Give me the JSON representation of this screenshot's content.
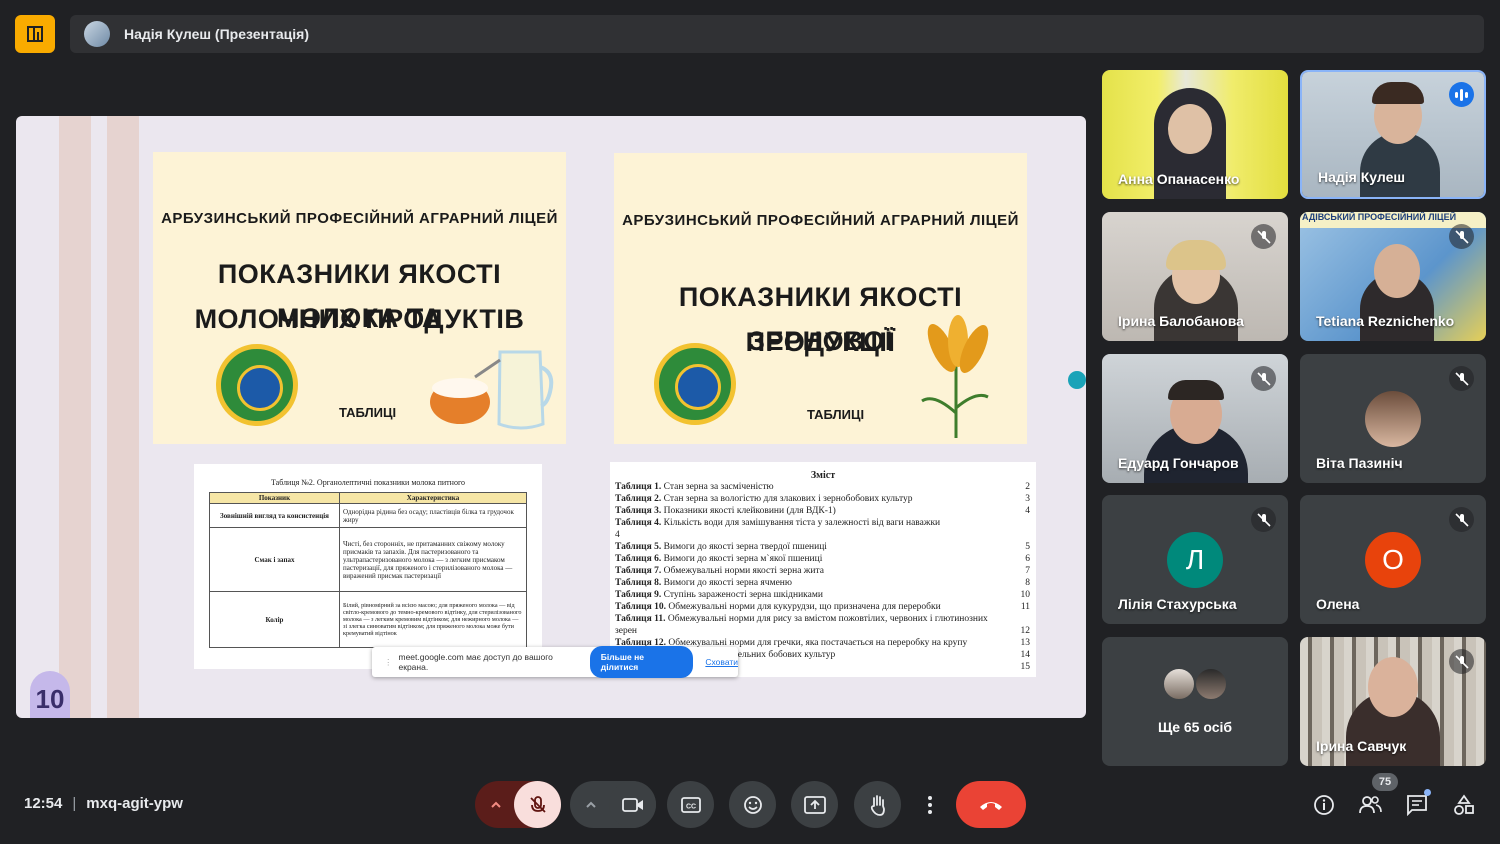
{
  "app": {
    "presenter_label": "Надія Кулеш (Презентація)"
  },
  "slide": {
    "page_number": "10",
    "card_left": {
      "school": "АРБУЗИНСЬКИЙ ПРОФЕСІЙНИЙ АГРАРНИЙ ЛІЦЕЙ",
      "title_line1": "ПОКАЗНИКИ ЯКОСТІ МОЛОКА ТА",
      "title_line2": "МОЛОЧНИХ ПРОДУКТІВ",
      "tables": "ТАБЛИЦІ"
    },
    "card_right": {
      "school": "АРБУЗИНСЬКИЙ ПРОФЕСІЙНИЙ АГРАРНИЙ ЛІЦЕЙ",
      "title_line1": "ПОКАЗНИКИ ЯКОСТІ ЗЕРНОВОЇ",
      "title_line2": "ПРОДУКЦІЇ",
      "tables": "ТАБЛИЦІ"
    },
    "doc_left": {
      "caption": "Таблиця №2. Органолептичні показники молока питного",
      "headers": [
        "Показник",
        "Характеристика"
      ],
      "rows": [
        {
          "label": "Зовнішній вигляд та консистенція",
          "text": "Однорідна рідина без осаду; пластівців білка та грудочок жиру"
        },
        {
          "label": "Смак і запах",
          "text": "Чисті, без сторонніх, не притаманних свіжому молоку присмаків та запахів. Для пастеризованого та ультрапастеризованого молока — з легким присмаком пастеризації, для пряженого і стерилізованого молока — виражений присмак пастеризації"
        },
        {
          "label": "Колір",
          "text": "Білий, рівномірний за всією масою; для пряженого молока — від світло-кремового до темно-кремового відтінку, для стерилізованого молока — з легким кремовим відтінком; для нежирного молока — зі злегка синюватим відтінком; для пряженого молока може бути кремуватий відтінок"
        }
      ]
    },
    "doc_right": {
      "title": "Зміст",
      "rows": [
        {
          "label": "Таблиця 1.",
          "text": "Стан зерна за засміченістю",
          "page": "2"
        },
        {
          "label": "Таблиця 2.",
          "text": "Стан зерна за вологістю для злакових і зернобобових культур",
          "page": "3"
        },
        {
          "label": "Таблиця 3.",
          "text": "Показники якості клейковини (для ВДК-1)",
          "page": "4"
        },
        {
          "label": "Таблиця 4.",
          "text": "Кількість води для замішування тіста у залежності від ваги наважки",
          "page": ""
        },
        {
          "label": "",
          "text": "4",
          "page": ""
        },
        {
          "label": "Таблиця 5.",
          "text": "Вимоги до якості зерна твердої пшениці",
          "page": "5"
        },
        {
          "label": "Таблиця 6.",
          "text": "Вимоги до якості зерна м`якої пшениці",
          "page": "6"
        },
        {
          "label": "Таблиця 7.",
          "text": "Обмежувальні норми якості зерна жита",
          "page": "7"
        },
        {
          "label": "Таблиця 8.",
          "text": "Вимоги до якості зерна ячменю",
          "page": "8"
        },
        {
          "label": "Таблиця 9.",
          "text": "Ступінь зараженості зерна шкідниками",
          "page": "10"
        },
        {
          "label": "Таблиця 10.",
          "text": "Обмежувальні норми для кукурудзи, що призначена для переробки",
          "page": "11"
        },
        {
          "label": "Таблиця 11.",
          "text": "Обмежувальні норми для рису за вмістом пожовтілих, червоних і глютинозних",
          "page": ""
        },
        {
          "label": "",
          "text": "зерен",
          "page": "12"
        },
        {
          "label": "Таблиця 12.",
          "text": "Обмежувальні норми для гречки, яка постачається на переробку на крупу",
          "page": "13"
        },
        {
          "label": "",
          "text": "н норми якості насіння заготівельних бобових культур",
          "page": "14"
        },
        {
          "label": "",
          "text": "нику за натурою",
          "page": "15"
        }
      ]
    },
    "share_bar": {
      "message": "meet.google.com має доступ до вашого екрана.",
      "stop_label": "Більше не ділитися",
      "hide_label": "Сховати"
    }
  },
  "participants": [
    {
      "name": "Анна Опанасенко",
      "muted": false
    },
    {
      "name": "Надія Кулеш",
      "speaking": true
    },
    {
      "name": "Ірина Балобанова",
      "muted": true
    },
    {
      "name": "Tetiana Reznichenko",
      "muted": true
    },
    {
      "name": "Едуард Гончаров",
      "muted": true
    },
    {
      "name": "Віта Пазиніч",
      "muted": true
    },
    {
      "name": "Лілія Стахурська",
      "initial": "Л",
      "color": "#00897b",
      "muted": true
    },
    {
      "name": "Олена",
      "initial": "О",
      "color": "#e8430c",
      "muted": true
    },
    {
      "name": "Ще 65 осіб"
    },
    {
      "name": "Ірина Савчук",
      "muted": true
    }
  ],
  "footer": {
    "time": "12:54",
    "meeting_code": "mxq-agit-ypw",
    "participants_count": "75"
  },
  "colors": {
    "background": "#202124",
    "end_call": "#ea4335",
    "accent": "#1a73e8",
    "logo": "#f9ab00"
  }
}
